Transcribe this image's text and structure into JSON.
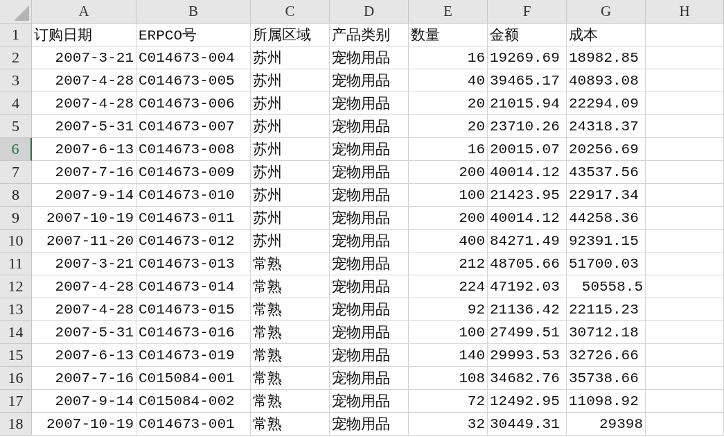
{
  "columns": [
    "A",
    "B",
    "C",
    "D",
    "E",
    "F",
    "G",
    "H"
  ],
  "rows": [
    {
      "header": "1",
      "selected": false,
      "cells": [
        {
          "text": "订购日期",
          "kind": "text"
        },
        {
          "text": "ERPCO号",
          "kind": "text"
        },
        {
          "text": "所属区域",
          "kind": "text"
        },
        {
          "text": "产品类别",
          "kind": "text"
        },
        {
          "text": "数量",
          "kind": "text"
        },
        {
          "text": "金额",
          "kind": "text"
        },
        {
          "text": "成本",
          "kind": "text"
        }
      ]
    },
    {
      "header": "2",
      "selected": false,
      "cells": [
        {
          "text": "2007-3-21",
          "kind": "number"
        },
        {
          "text": "C014673-004",
          "kind": "text"
        },
        {
          "text": "苏州",
          "kind": "text"
        },
        {
          "text": "宠物用品",
          "kind": "text"
        },
        {
          "text": "16",
          "kind": "number"
        },
        {
          "text": "19269.69",
          "kind": "text"
        },
        {
          "text": "18982.85",
          "kind": "text"
        }
      ]
    },
    {
      "header": "3",
      "selected": false,
      "cells": [
        {
          "text": "2007-4-28",
          "kind": "number"
        },
        {
          "text": "C014673-005",
          "kind": "text"
        },
        {
          "text": "苏州",
          "kind": "text"
        },
        {
          "text": "宠物用品",
          "kind": "text"
        },
        {
          "text": "40",
          "kind": "number"
        },
        {
          "text": "39465.17",
          "kind": "text"
        },
        {
          "text": "40893.08",
          "kind": "text"
        }
      ]
    },
    {
      "header": "4",
      "selected": false,
      "cells": [
        {
          "text": "2007-4-28",
          "kind": "number"
        },
        {
          "text": "C014673-006",
          "kind": "text"
        },
        {
          "text": "苏州",
          "kind": "text"
        },
        {
          "text": "宠物用品",
          "kind": "text"
        },
        {
          "text": "20",
          "kind": "number"
        },
        {
          "text": "21015.94",
          "kind": "text"
        },
        {
          "text": "22294.09",
          "kind": "text"
        }
      ]
    },
    {
      "header": "5",
      "selected": false,
      "cells": [
        {
          "text": "2007-5-31",
          "kind": "number"
        },
        {
          "text": "C014673-007",
          "kind": "text"
        },
        {
          "text": "苏州",
          "kind": "text"
        },
        {
          "text": "宠物用品",
          "kind": "text"
        },
        {
          "text": "20",
          "kind": "number"
        },
        {
          "text": "23710.26",
          "kind": "text"
        },
        {
          "text": "24318.37",
          "kind": "text"
        }
      ]
    },
    {
      "header": "6",
      "selected": true,
      "cells": [
        {
          "text": "2007-6-13",
          "kind": "number"
        },
        {
          "text": "C014673-008",
          "kind": "text"
        },
        {
          "text": "苏州",
          "kind": "text"
        },
        {
          "text": "宠物用品",
          "kind": "text"
        },
        {
          "text": "16",
          "kind": "number"
        },
        {
          "text": "20015.07",
          "kind": "text"
        },
        {
          "text": "20256.69",
          "kind": "text"
        }
      ]
    },
    {
      "header": "7",
      "selected": false,
      "cells": [
        {
          "text": "2007-7-16",
          "kind": "number"
        },
        {
          "text": "C014673-009",
          "kind": "text"
        },
        {
          "text": "苏州",
          "kind": "text"
        },
        {
          "text": "宠物用品",
          "kind": "text"
        },
        {
          "text": "200",
          "kind": "number"
        },
        {
          "text": "40014.12",
          "kind": "text"
        },
        {
          "text": "43537.56",
          "kind": "text"
        }
      ]
    },
    {
      "header": "8",
      "selected": false,
      "cells": [
        {
          "text": "2007-9-14",
          "kind": "number"
        },
        {
          "text": "C014673-010",
          "kind": "text"
        },
        {
          "text": "苏州",
          "kind": "text"
        },
        {
          "text": "宠物用品",
          "kind": "text"
        },
        {
          "text": "100",
          "kind": "number"
        },
        {
          "text": "21423.95",
          "kind": "text"
        },
        {
          "text": "22917.34",
          "kind": "text"
        }
      ]
    },
    {
      "header": "9",
      "selected": false,
      "cells": [
        {
          "text": "2007-10-19",
          "kind": "number"
        },
        {
          "text": "C014673-011",
          "kind": "text"
        },
        {
          "text": "苏州",
          "kind": "text"
        },
        {
          "text": "宠物用品",
          "kind": "text"
        },
        {
          "text": "200",
          "kind": "number"
        },
        {
          "text": "40014.12",
          "kind": "text"
        },
        {
          "text": "44258.36",
          "kind": "text"
        }
      ]
    },
    {
      "header": "10",
      "selected": false,
      "cells": [
        {
          "text": "2007-11-20",
          "kind": "number"
        },
        {
          "text": "C014673-012",
          "kind": "text"
        },
        {
          "text": "苏州",
          "kind": "text"
        },
        {
          "text": "宠物用品",
          "kind": "text"
        },
        {
          "text": "400",
          "kind": "number"
        },
        {
          "text": "84271.49",
          "kind": "text"
        },
        {
          "text": "92391.15",
          "kind": "text"
        }
      ]
    },
    {
      "header": "11",
      "selected": false,
      "cells": [
        {
          "text": "2007-3-21",
          "kind": "number"
        },
        {
          "text": "C014673-013",
          "kind": "text"
        },
        {
          "text": "常熟",
          "kind": "text"
        },
        {
          "text": "宠物用品",
          "kind": "text"
        },
        {
          "text": "212",
          "kind": "number"
        },
        {
          "text": "48705.66",
          "kind": "text"
        },
        {
          "text": "51700.03",
          "kind": "text"
        }
      ]
    },
    {
      "header": "12",
      "selected": false,
      "cells": [
        {
          "text": "2007-4-28",
          "kind": "number"
        },
        {
          "text": "C014673-014",
          "kind": "text"
        },
        {
          "text": "常熟",
          "kind": "text"
        },
        {
          "text": "宠物用品",
          "kind": "text"
        },
        {
          "text": "224",
          "kind": "number"
        },
        {
          "text": "47192.03",
          "kind": "text"
        },
        {
          "text": "50558.5",
          "kind": "number"
        }
      ]
    },
    {
      "header": "13",
      "selected": false,
      "cells": [
        {
          "text": "2007-4-28",
          "kind": "number"
        },
        {
          "text": "C014673-015",
          "kind": "text"
        },
        {
          "text": "常熟",
          "kind": "text"
        },
        {
          "text": "宠物用品",
          "kind": "text"
        },
        {
          "text": "92",
          "kind": "number"
        },
        {
          "text": "21136.42",
          "kind": "text"
        },
        {
          "text": "22115.23",
          "kind": "text"
        }
      ]
    },
    {
      "header": "14",
      "selected": false,
      "cells": [
        {
          "text": "2007-5-31",
          "kind": "number"
        },
        {
          "text": "C014673-016",
          "kind": "text"
        },
        {
          "text": "常熟",
          "kind": "text"
        },
        {
          "text": "宠物用品",
          "kind": "text"
        },
        {
          "text": "100",
          "kind": "number"
        },
        {
          "text": "27499.51",
          "kind": "text"
        },
        {
          "text": "30712.18",
          "kind": "text"
        }
      ]
    },
    {
      "header": "15",
      "selected": false,
      "cells": [
        {
          "text": "2007-6-13",
          "kind": "number"
        },
        {
          "text": "C014673-019",
          "kind": "text"
        },
        {
          "text": "常熟",
          "kind": "text"
        },
        {
          "text": "宠物用品",
          "kind": "text"
        },
        {
          "text": "140",
          "kind": "number"
        },
        {
          "text": "29993.53",
          "kind": "text"
        },
        {
          "text": "32726.66",
          "kind": "text"
        }
      ]
    },
    {
      "header": "16",
      "selected": false,
      "cells": [
        {
          "text": "2007-7-16",
          "kind": "number"
        },
        {
          "text": "C015084-001",
          "kind": "text"
        },
        {
          "text": "常熟",
          "kind": "text"
        },
        {
          "text": "宠物用品",
          "kind": "text"
        },
        {
          "text": "108",
          "kind": "number"
        },
        {
          "text": "34682.76",
          "kind": "text"
        },
        {
          "text": "35738.66",
          "kind": "text"
        }
      ]
    },
    {
      "header": "17",
      "selected": false,
      "cells": [
        {
          "text": "2007-9-14",
          "kind": "number"
        },
        {
          "text": "C015084-002",
          "kind": "text"
        },
        {
          "text": "常熟",
          "kind": "text"
        },
        {
          "text": "宠物用品",
          "kind": "text"
        },
        {
          "text": "72",
          "kind": "number"
        },
        {
          "text": "12492.95",
          "kind": "text"
        },
        {
          "text": "11098.92",
          "kind": "text"
        }
      ]
    },
    {
      "header": "18",
      "selected": false,
      "cells": [
        {
          "text": "2007-10-19",
          "kind": "number"
        },
        {
          "text": "C014673-001",
          "kind": "text"
        },
        {
          "text": "常熟",
          "kind": "text"
        },
        {
          "text": "宠物用品",
          "kind": "text"
        },
        {
          "text": "32",
          "kind": "number"
        },
        {
          "text": "30449.31",
          "kind": "text"
        },
        {
          "text": "29398",
          "kind": "number"
        }
      ]
    }
  ]
}
